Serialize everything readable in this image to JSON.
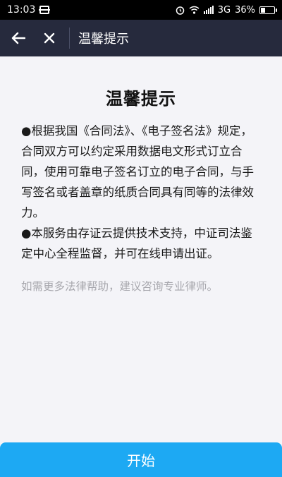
{
  "status_bar": {
    "time": "13:03",
    "network": "3G",
    "battery": "36%",
    "battery_level": 0.36
  },
  "header": {
    "title": "温馨提示",
    "back_icon": "arrow-left-icon",
    "close_icon": "close-icon"
  },
  "main": {
    "heading": "温馨提示",
    "paragraphs": [
      "●根据我国《合同法》、《电子签名法》规定，合同双方可以约定采用数据电文形式订立合同，使用可靠电子签名订立的电子合同，与手写签名或者盖章的纸质合同具有同等的法律效力。",
      "●本服务由存证云提供技术支持，中证司法鉴定中心全程监督，并可在线申请出证。"
    ],
    "note": "如需更多法律帮助，建议咨询专业律师。"
  },
  "footer": {
    "start_label": "开始"
  },
  "colors": {
    "app_bar": "#262a3d",
    "accent": "#1da9f3",
    "background": "#f4f4f8"
  }
}
